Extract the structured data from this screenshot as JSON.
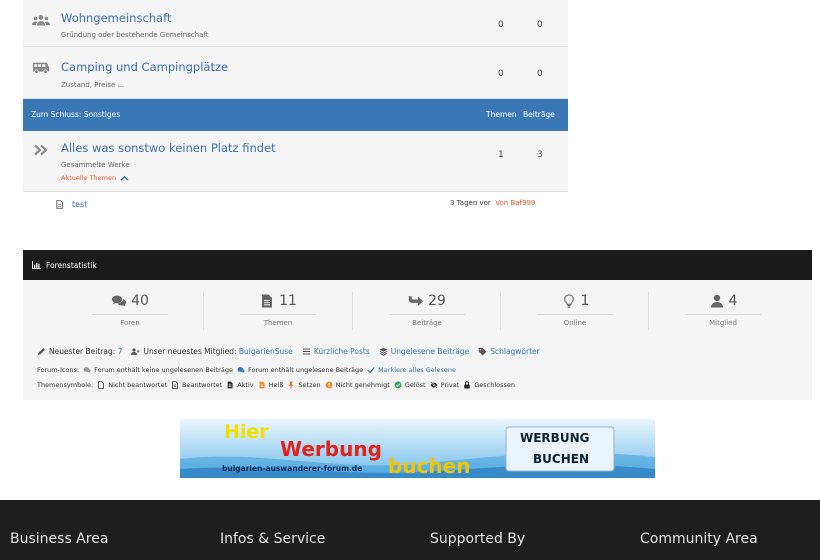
{
  "forums": [
    {
      "title": "Wohngemeinschaft",
      "description": "Gründung oder bestehende Gemeinschaft",
      "themen": "0",
      "beitraege": "0",
      "icon": "users-icon"
    },
    {
      "title": "Camping und Campingplätze",
      "description": "Zustand, Preise ...",
      "themen": "0",
      "beitraege": "0",
      "icon": "bus-icon"
    }
  ],
  "category": {
    "title": "Zum Schluss: Sonstiges",
    "col_themen": "Themen",
    "col_beitraege": "Beiträge",
    "color": "#3a78b5"
  },
  "last_forum": {
    "title": "Alles was sonstwo keinen Platz findet",
    "description": "Gesammelte Werke",
    "toggle_label": "Aktuelle Themen",
    "themen": "1",
    "beitraege": "3",
    "icon": "double-chevron-right-icon"
  },
  "subtopic": {
    "title": "test",
    "date": "3 Tagen vor",
    "author": "Von Baf999"
  },
  "stats": {
    "title": "Forenstatistik",
    "items": [
      {
        "value": "40",
        "label": "Foren",
        "icon": "comments-icon"
      },
      {
        "value": "11",
        "label": "Themen",
        "icon": "file-icon"
      },
      {
        "value": "29",
        "label": "Beiträge",
        "icon": "reply-arrow-icon"
      },
      {
        "value": "1",
        "label": "Online",
        "icon": "lightbulb-icon"
      },
      {
        "value": "4",
        "label": "Mitglied",
        "icon": "user-icon"
      }
    ],
    "newest_post_label": "Neuester Beitrag:",
    "newest_post_value": "7",
    "newest_member_label": "Unser neuestes Mitglied:",
    "newest_member_value": "BulgarienSuse",
    "recent_posts": "Kürzliche Posts",
    "unread_posts": "Ungelesene Beiträge",
    "tags": "Schlagwörter"
  },
  "legend_icons": {
    "label": "Forum-Icons:",
    "no_unread": "Forum enthält keine ungelesenen Beiträge",
    "has_unread": "Forum enthält ungelesene Beiträge",
    "mark_read": "Markiere alles Gelesene"
  },
  "legend_topics": {
    "label": "Themensymbole:",
    "unanswered": "Nicht beantwortet",
    "answered": "Beantwortet",
    "active": "Aktiv",
    "hot": "Heiß",
    "sticky": "Setzen",
    "unapproved": "Nicht genehmigt",
    "solved": "Gelöst",
    "private": "Privat",
    "closed": "Geschlossen"
  },
  "banner": {
    "hier": "Hier",
    "werbung": "Werbung",
    "url": "bulgarien-auswanderer-forum.de",
    "buchen": "buchen",
    "box_line1": "WERBUNG",
    "box_line2": "BUCHEN"
  },
  "footer": [
    "Business Area",
    "Infos & Service",
    "Supported By",
    "Community Area"
  ],
  "colors": {
    "link": "#3a6fb0",
    "accent_orange": "#e05a2b",
    "header_blue": "#3a78b5",
    "stats_header": "#1b1b1b",
    "footer": "#1e1e1e"
  }
}
